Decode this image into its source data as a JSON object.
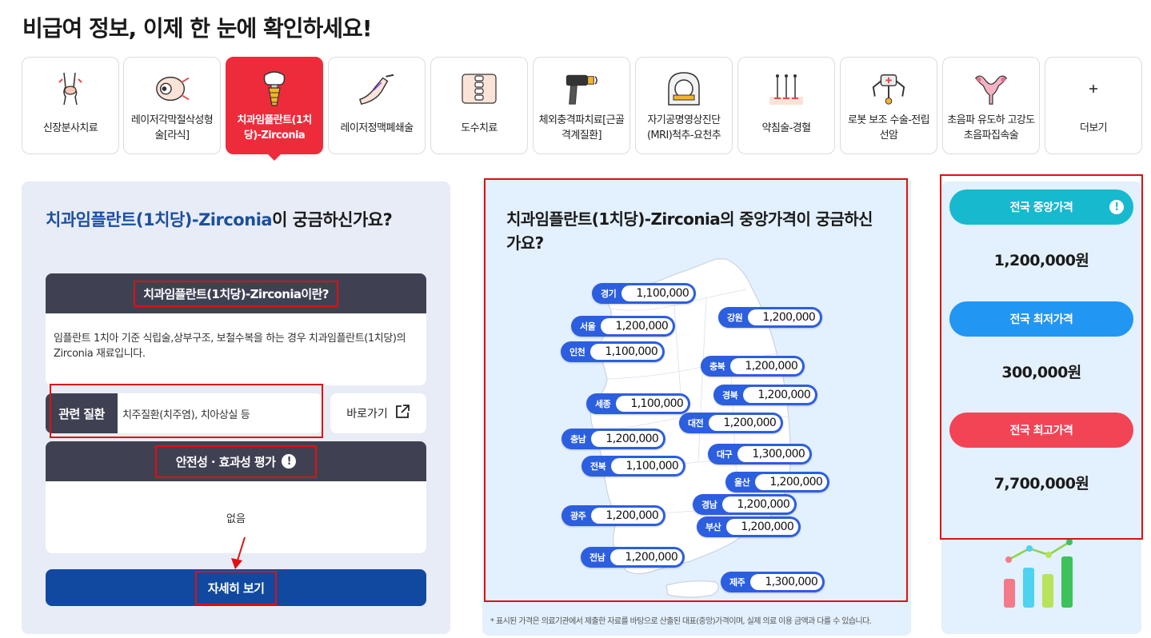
{
  "page": {
    "title": "비급여 정보, 이제 한 눈에 확인하세요!"
  },
  "tabs": [
    {
      "label": "신장분사치료",
      "icon": "joint-icon"
    },
    {
      "label": "레이저각막절삭성형술[라식]",
      "icon": "eye-icon"
    },
    {
      "label": "치과임플란트(1치당)-Zirconia",
      "icon": "tooth-implant-icon",
      "active": true
    },
    {
      "label": "레이저정맥폐쇄술",
      "icon": "leg-vein-icon"
    },
    {
      "label": "도수치료",
      "icon": "spine-icon"
    },
    {
      "label": "체외충격파치료[근골격계질환]",
      "icon": "shockwave-device-icon"
    },
    {
      "label": "자기공명영상진단(MRI)척추-요천추",
      "icon": "mri-icon"
    },
    {
      "label": "약침술-경혈",
      "icon": "acupuncture-icon"
    },
    {
      "label": "로봇 보조 수술-전립선암",
      "icon": "robot-surgery-icon"
    },
    {
      "label": "초음파 유도하 고강도초음파집속술",
      "icon": "uterus-icon"
    },
    {
      "label": "더보기",
      "icon": "plus-icon"
    }
  ],
  "left": {
    "question_highlight": "치과임플란트(1치당)-Zirconia",
    "question_rest": "이 궁금하신가요?",
    "definition_title": "치과임플란트(1치당)-Zirconia이란?",
    "definition_text": "임플란트 1치아 기준 식립술,상부구조, 보철수복을 하는 경우 치과임플란트(1치당)의 Zirconia 재료입니다.",
    "disease_label": "관련 질환",
    "disease_value": "치주질환(치주염), 치아상실 등",
    "goto_label": "바로가기",
    "safety_title": "안전성 · 효과성 평가",
    "safety_value": "없음",
    "detail_button": "자세히 보기"
  },
  "map": {
    "title": "치과임플란트(1치당)-Zirconia의 중앙가격이 궁금하신가요?",
    "note": "* 표시된 가격은 의료기관에서 제출한 자료를 바탕으로 산출된 대표(중앙)가격이며, 실제 의료 이용 금액과 다를 수 있습니다.",
    "regions": [
      {
        "name": "경기",
        "price": "1,100,000"
      },
      {
        "name": "서울",
        "price": "1,200,000"
      },
      {
        "name": "인천",
        "price": "1,100,000"
      },
      {
        "name": "강원",
        "price": "1,200,000"
      },
      {
        "name": "충북",
        "price": "1,200,000"
      },
      {
        "name": "경북",
        "price": "1,200,000"
      },
      {
        "name": "세종",
        "price": "1,100,000"
      },
      {
        "name": "대전",
        "price": "1,200,000"
      },
      {
        "name": "충남",
        "price": "1,200,000"
      },
      {
        "name": "대구",
        "price": "1,300,000"
      },
      {
        "name": "전북",
        "price": "1,100,000"
      },
      {
        "name": "울산",
        "price": "1,200,000"
      },
      {
        "name": "경남",
        "price": "1,200,000"
      },
      {
        "name": "광주",
        "price": "1,200,000"
      },
      {
        "name": "부산",
        "price": "1,200,000"
      },
      {
        "name": "전남",
        "price": "1,200,000"
      },
      {
        "name": "제주",
        "price": "1,300,000"
      }
    ]
  },
  "prices": {
    "median_label": "전국 중앙가격",
    "median_value": "1,200,000원",
    "min_label": "전국 최저가격",
    "min_value": "300,000원",
    "max_label": "전국 최고가격",
    "max_value": "7,700,000원"
  },
  "colors": {
    "active_tab": "#ed2b3b",
    "navy": "#1149a0",
    "dark_header": "#3f4153",
    "pill_blue": "#2c5ee0",
    "median": "#17b9cf",
    "min": "#2196f3",
    "max": "#f24455",
    "highlight_outline": "#e01010"
  }
}
